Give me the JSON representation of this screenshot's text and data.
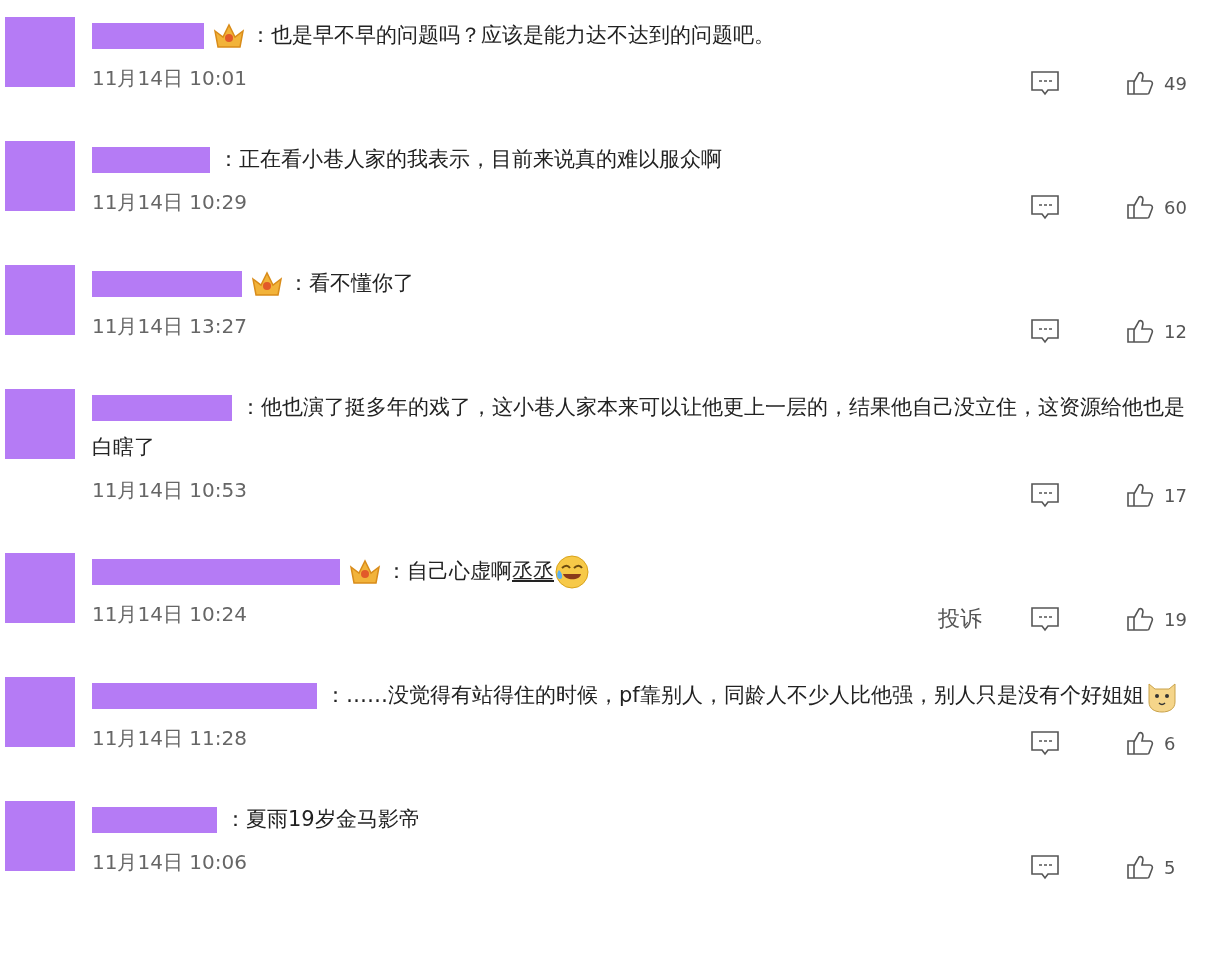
{
  "comments": [
    {
      "badge": true,
      "kind": "plain",
      "text": "：也是早不早的问题吗？应该是能力达不达到的问题吧。",
      "time": "11月14日 10:01",
      "likes": "49"
    },
    {
      "badge": false,
      "kind": "plain",
      "text": "：正在看小巷人家的我表示，目前来说真的难以服众啊",
      "time": "11月14日 10:29",
      "likes": "60"
    },
    {
      "badge": true,
      "kind": "plain",
      "text": "：看不懂你了",
      "time": "11月14日 13:27",
      "likes": "12"
    },
    {
      "badge": false,
      "kind": "plain",
      "text": "：他也演了挺多年的戏了，这小巷人家本来可以让他更上一层的，结果他自己没立住，这资源给他也是白瞎了",
      "time": "11月14日 10:53",
      "likes": "17"
    },
    {
      "badge": true,
      "kind": "laugh",
      "text": "：自己心虚啊",
      "link": "丞丞",
      "time": "11月14日 10:24",
      "report": "投诉",
      "likes": "19"
    },
    {
      "badge": false,
      "kind": "dog",
      "text": "：……没觉得有站得住的时候，pf靠别人，同龄人不少人比他强，别人只是没有个好姐姐",
      "time": "11月14日 11:28",
      "likes": "6"
    },
    {
      "badge": false,
      "kind": "plain",
      "text": "：夏雨19岁金马影帝",
      "time": "11月14日 10:06",
      "likes": "5"
    }
  ]
}
